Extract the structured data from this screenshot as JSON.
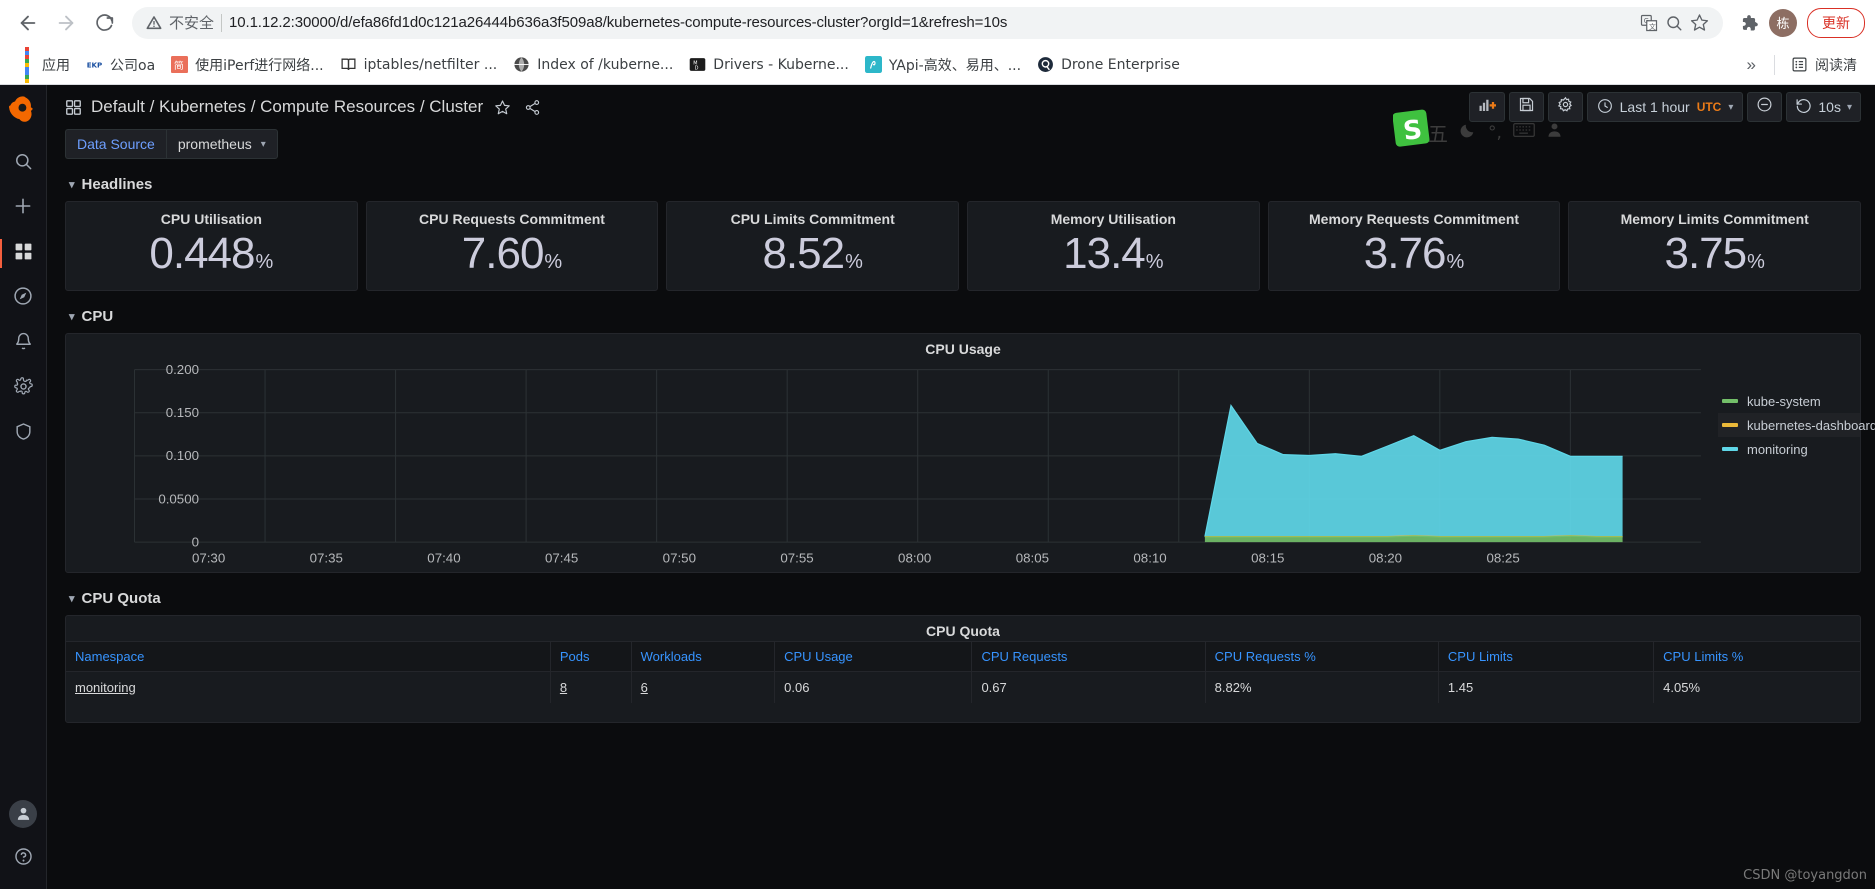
{
  "browser": {
    "back_icon": "back-arrow-icon",
    "forward_icon": "forward-arrow-icon",
    "reload_icon": "reload-icon",
    "security_label": "不安全",
    "url": "10.1.12.2:30000/d/efa86fd1d0c121a26444b636a3f509a8/kubernetes-compute-resources-cluster?orgId=1&refresh=10s",
    "translate_icon": "translate-icon",
    "search_icon": "search-page-icon",
    "bookmark_icon": "star-icon",
    "extensions_icon": "puzzle-piece-icon",
    "profile_initial": "栋",
    "update_label": "更新",
    "bookmarks": [
      {
        "label": "应用",
        "icon": "apps-grid-icon"
      },
      {
        "label": "公司oa",
        "icon": "ekp-icon"
      },
      {
        "label": "使用iPerf进行网络...",
        "icon": "jianshu-icon"
      },
      {
        "label": "iptables/netfilter ...",
        "icon": "book-icon"
      },
      {
        "label": "Index of /kuberne...",
        "icon": "globe-icon"
      },
      {
        "label": "Drivers - Kuberne...",
        "icon": "markdown-icon"
      },
      {
        "label": "YApi-高效、易用、...",
        "icon": "yapi-icon"
      },
      {
        "label": "Drone Enterprise",
        "icon": "drone-icon"
      }
    ],
    "overflow_label": "»",
    "reading_list_label": "阅读清",
    "reading_list_icon": "reading-list-icon"
  },
  "sidenav": {
    "logo": "grafana-logo-icon",
    "items": [
      {
        "name": "search",
        "icon": "search-icon"
      },
      {
        "name": "create",
        "icon": "plus-icon"
      },
      {
        "name": "dashboards",
        "icon": "dashboards-grid-icon"
      },
      {
        "name": "explore",
        "icon": "compass-icon"
      },
      {
        "name": "alerting",
        "icon": "bell-icon"
      },
      {
        "name": "configuration",
        "icon": "gear-icon"
      },
      {
        "name": "server-admin",
        "icon": "shield-icon"
      }
    ],
    "bottom": [
      {
        "name": "user-profile",
        "icon": "user-avatar-icon"
      },
      {
        "name": "help",
        "icon": "question-circle-icon"
      }
    ]
  },
  "header": {
    "grid_icon": "dashboard-grid-icon",
    "breadcrumb": "Default / Kubernetes / Compute Resources / Cluster",
    "breadcrumb_parts": [
      "Default",
      "Kubernetes",
      "Compute Resources",
      "Cluster"
    ],
    "star_icon": "star-outline-icon",
    "share_icon": "share-nodes-icon",
    "add_panel_icon": "add-panel-icon",
    "save_icon": "save-disk-icon",
    "settings_icon": "gear-icon",
    "time_clock_icon": "clock-icon",
    "time_range": "Last 1 hour",
    "timezone": "UTC",
    "zoom_out_icon": "zoom-out-icon",
    "refresh_icon": "refresh-icon",
    "refresh_interval": "10s",
    "chevron_icon": "chevron-down-icon"
  },
  "variables": {
    "datasource_label": "Data Source",
    "datasource_value": "prometheus"
  },
  "rows": {
    "headlines": "Headlines",
    "cpu": "CPU",
    "cpu_quota": "CPU Quota"
  },
  "stats": [
    {
      "title": "CPU Utilisation",
      "value": "0.448",
      "unit": "%"
    },
    {
      "title": "CPU Requests Commitment",
      "value": "7.60",
      "unit": "%"
    },
    {
      "title": "CPU Limits Commitment",
      "value": "8.52",
      "unit": "%"
    },
    {
      "title": "Memory Utilisation",
      "value": "13.4",
      "unit": "%"
    },
    {
      "title": "Memory Requests Commitment",
      "value": "3.76",
      "unit": "%"
    },
    {
      "title": "Memory Limits Commitment",
      "value": "3.75",
      "unit": "%"
    }
  ],
  "cpu_usage_panel": {
    "title": "CPU Usage"
  },
  "chart_data": {
    "type": "area",
    "title": "CPU Usage",
    "xlabel": "",
    "ylabel": "",
    "ylim": [
      0,
      0.2
    ],
    "yticks": [
      "0",
      "0.0500",
      "0.100",
      "0.150",
      "0.200"
    ],
    "ytick_values": [
      0,
      0.05,
      0.1,
      0.15,
      0.2
    ],
    "xticks": [
      "07:30",
      "07:35",
      "07:40",
      "07:45",
      "07:50",
      "07:55",
      "08:00",
      "08:05",
      "08:10",
      "08:15",
      "08:20",
      "08:25"
    ],
    "grid": true,
    "legend_position": "right",
    "stacked": true,
    "series": [
      {
        "name": "kube-system",
        "color": "#73bf69",
        "x": [
          "08:11",
          "08:12",
          "08:13",
          "08:14",
          "08:15",
          "08:16",
          "08:17",
          "08:18",
          "08:19",
          "08:20",
          "08:21",
          "08:22",
          "08:23",
          "08:24",
          "08:25",
          "08:26",
          "08:27"
        ],
        "values": [
          0.006,
          0.006,
          0.006,
          0.006,
          0.006,
          0.006,
          0.006,
          0.006,
          0.007,
          0.006,
          0.006,
          0.006,
          0.006,
          0.006,
          0.007,
          0.006,
          0.006
        ]
      },
      {
        "name": "kubernetes-dashboard",
        "color": "#eab839",
        "x": [
          "08:11",
          "08:12",
          "08:13",
          "08:14",
          "08:15",
          "08:16",
          "08:17",
          "08:18",
          "08:19",
          "08:20",
          "08:21",
          "08:22",
          "08:23",
          "08:24",
          "08:25",
          "08:26",
          "08:27"
        ],
        "values": [
          0.0005,
          0.0005,
          0.0005,
          0.0005,
          0.0005,
          0.0005,
          0.0005,
          0.0005,
          0.0005,
          0.0005,
          0.0005,
          0.0005,
          0.0005,
          0.0005,
          0.0005,
          0.0005,
          0.0005
        ]
      },
      {
        "name": "monitoring",
        "color": "#5fd7e8",
        "x": [
          "08:11",
          "08:12",
          "08:13",
          "08:14",
          "08:15",
          "08:16",
          "08:17",
          "08:18",
          "08:19",
          "08:20",
          "08:21",
          "08:22",
          "08:23",
          "08:24",
          "08:25",
          "08:26",
          "08:27"
        ],
        "values": [
          0.0,
          0.152,
          0.108,
          0.095,
          0.094,
          0.096,
          0.093,
          0.105,
          0.116,
          0.1,
          0.11,
          0.115,
          0.113,
          0.106,
          0.092,
          0.093,
          0.093
        ]
      }
    ],
    "legend": [
      {
        "label": "kube-system",
        "color": "#73bf69"
      },
      {
        "label": "kubernetes-dashboard",
        "color": "#eab839"
      },
      {
        "label": "monitoring",
        "color": "#5fd7e8"
      }
    ]
  },
  "cpu_quota_table": {
    "title": "CPU Quota",
    "columns": [
      "Namespace",
      "Pods",
      "Workloads",
      "CPU Usage",
      "CPU Requests",
      "CPU Requests %",
      "CPU Limits",
      "CPU Limits %"
    ],
    "rows": [
      {
        "namespace": "monitoring",
        "pods": "8",
        "workloads": "6",
        "cpu_usage": "0.06",
        "cpu_requests": "0.67",
        "cpu_requests_pct": "8.82%",
        "cpu_limits": "1.45",
        "cpu_limits_pct": "4.05%"
      }
    ]
  },
  "watermark": {
    "text": "CSDN @toyangdon"
  }
}
